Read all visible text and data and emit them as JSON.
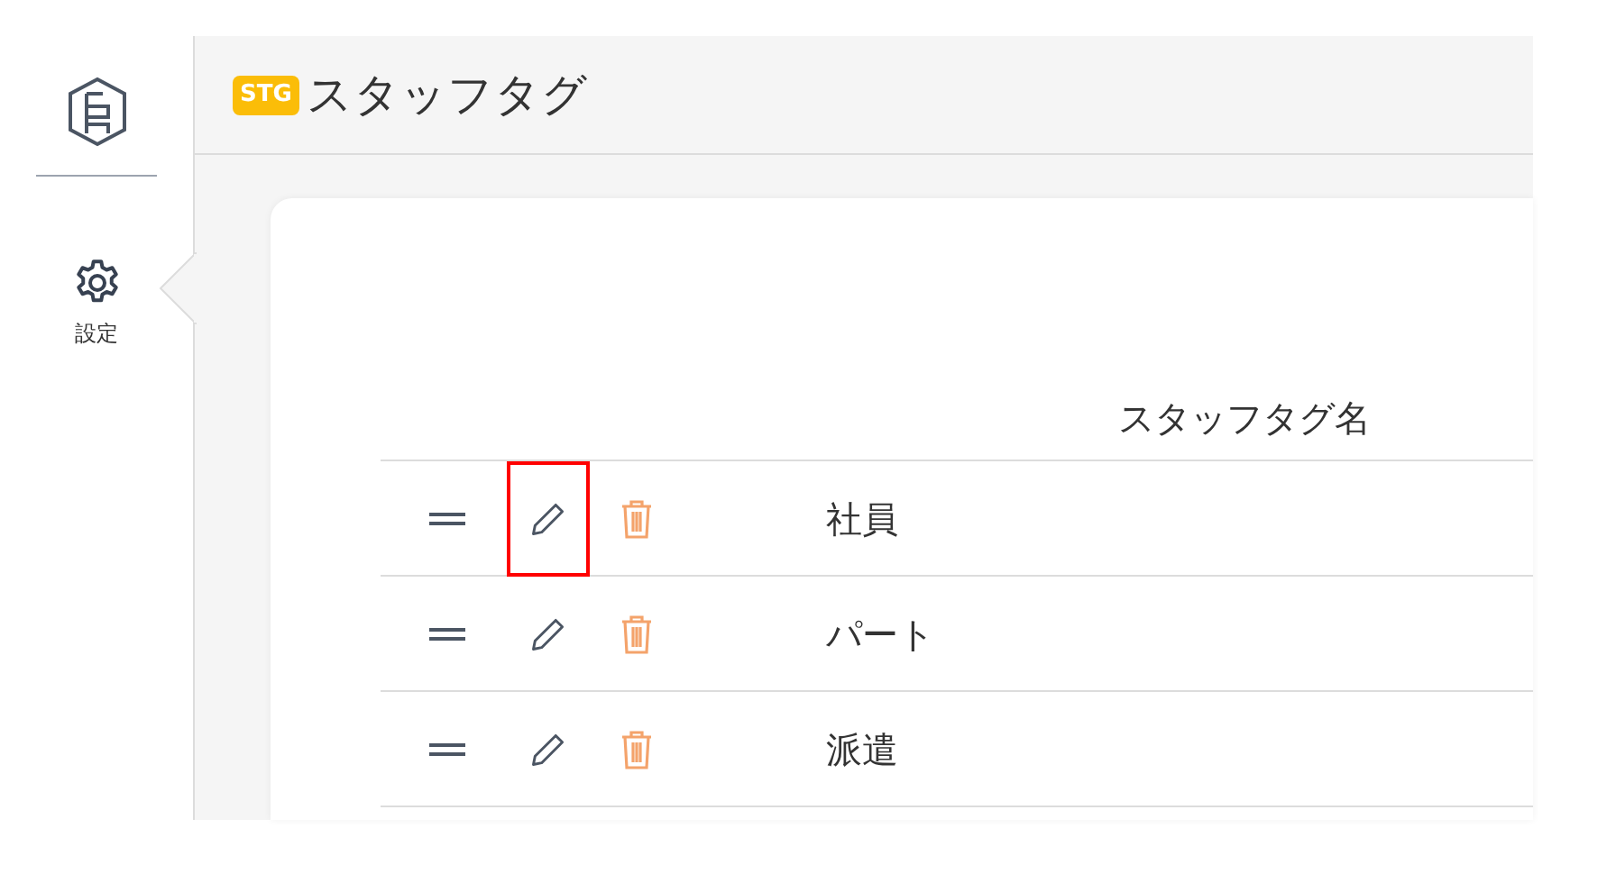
{
  "header": {
    "badge": "STG",
    "title": "スタッフタグ"
  },
  "sidebar": {
    "items": [
      {
        "label": "設定",
        "selected": true
      }
    ]
  },
  "table": {
    "columns": [
      "スタッフタグ名"
    ],
    "rows": [
      {
        "name": "社員",
        "edit_highlighted": true
      },
      {
        "name": "パート",
        "edit_highlighted": false
      },
      {
        "name": "派遣",
        "edit_highlighted": false
      }
    ]
  }
}
